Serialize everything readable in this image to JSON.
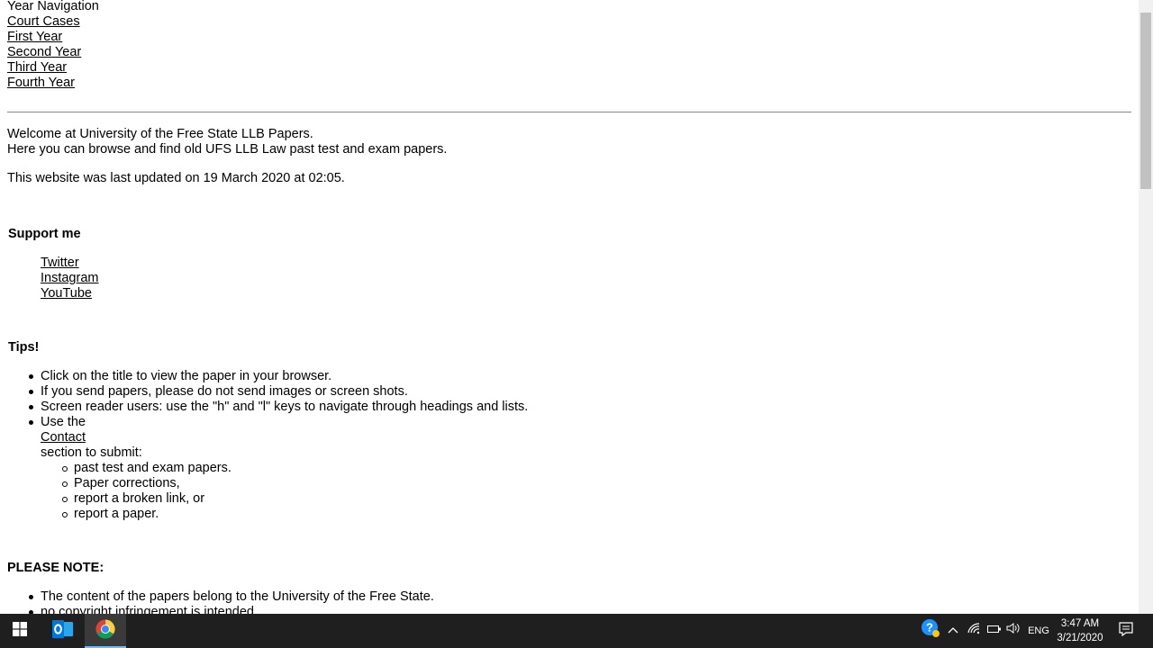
{
  "nav": {
    "heading": "Year Navigation",
    "links": [
      "Court Cases",
      "First Year",
      "Second Year",
      "Third Year",
      "Fourth Year"
    ]
  },
  "intro": {
    "welcome": "Welcome at University of the Free State LLB Papers.",
    "browse": "Here you can browse and find old UFS LLB Law past test and exam papers.",
    "updated": "This website was last updated on 19 March 2020 at 02:05."
  },
  "support": {
    "heading": "Support me",
    "links": [
      "Twitter",
      "Instagram",
      "YouTube"
    ]
  },
  "tips": {
    "heading": "Tips!",
    "items": [
      "Click on the title to view the paper in your browser.",
      "If you send papers, please do not send images or screen shots.",
      "Screen reader users: use the \"h\" and \"l\" keys to navigate through headings and lists."
    ],
    "use_the": "Use the",
    "contact_link": "Contact",
    "section_to_submit": "section to submit:",
    "submit_items": [
      "past test and exam papers.",
      "Paper corrections,",
      "report a broken link, or",
      "report a paper."
    ]
  },
  "note": {
    "heading": "PLEASE NOTE:",
    "items": [
      "The content of the papers belong to the University of the Free State.",
      "no copyright infringement is intended."
    ]
  },
  "taskbar": {
    "lang": "ENG",
    "time": "3:47 AM",
    "date": "3/21/2020",
    "icons": [
      "windows-start-icon",
      "outlook-icon",
      "chrome-icon",
      "help-icon",
      "chevron-up-icon",
      "wifi-icon",
      "battery-icon",
      "volume-icon",
      "notification-icon"
    ]
  },
  "colors": {
    "taskbar": "#1f1f1f",
    "active_indicator": "#76b9ed"
  }
}
